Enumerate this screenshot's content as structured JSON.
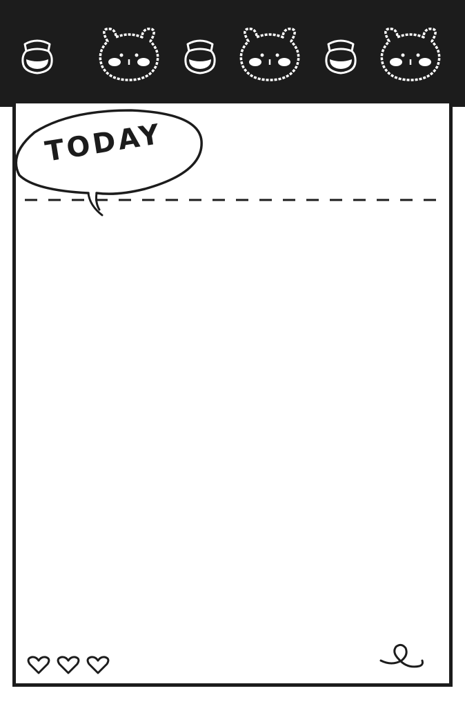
{
  "header": {
    "background": "#1c1c1c",
    "icons": [
      "jam-jar-icon",
      "bear-face-icon",
      "jam-jar-icon",
      "bear-face-icon",
      "jam-jar-icon",
      "bear-face-icon"
    ]
  },
  "note": {
    "title": "TODAY",
    "bubble_icon": "speech-bubble-icon",
    "footer_icons": [
      "heart-icon",
      "heart-icon",
      "heart-icon",
      "loop-doodle-icon"
    ],
    "line_color": "#1c1c1c"
  }
}
